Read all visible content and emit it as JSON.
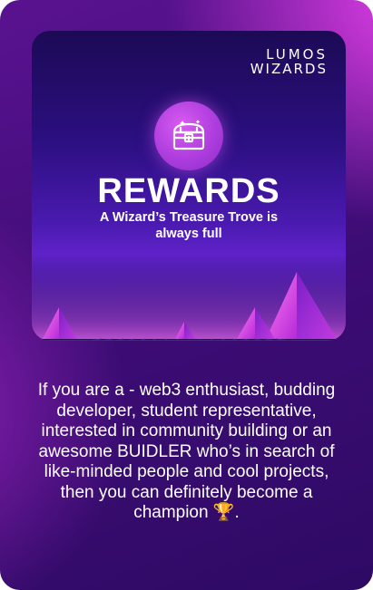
{
  "banner": {
    "logo_line1": "LUMOS",
    "logo_line2": "WIZARDS",
    "chest_icon": "treasure-chest-icon",
    "title": "REWARDS",
    "subtitle": "A Wizard’s Treasure Trove is always full"
  },
  "description": {
    "text": "If you are a - web3 enthusiast, budding developer, student representative, interested in community building or an awesome BUIDLER who’s in search of like-minded people and cool projects, then you can definitely become a champion 🏆."
  },
  "colors": {
    "card_gradient_top": "#5a1290",
    "card_accent_pink": "#e13fe6",
    "banner_dark": "#1c0a55",
    "badge_purple": "#b23fe0",
    "text_white": "#ffffff"
  }
}
